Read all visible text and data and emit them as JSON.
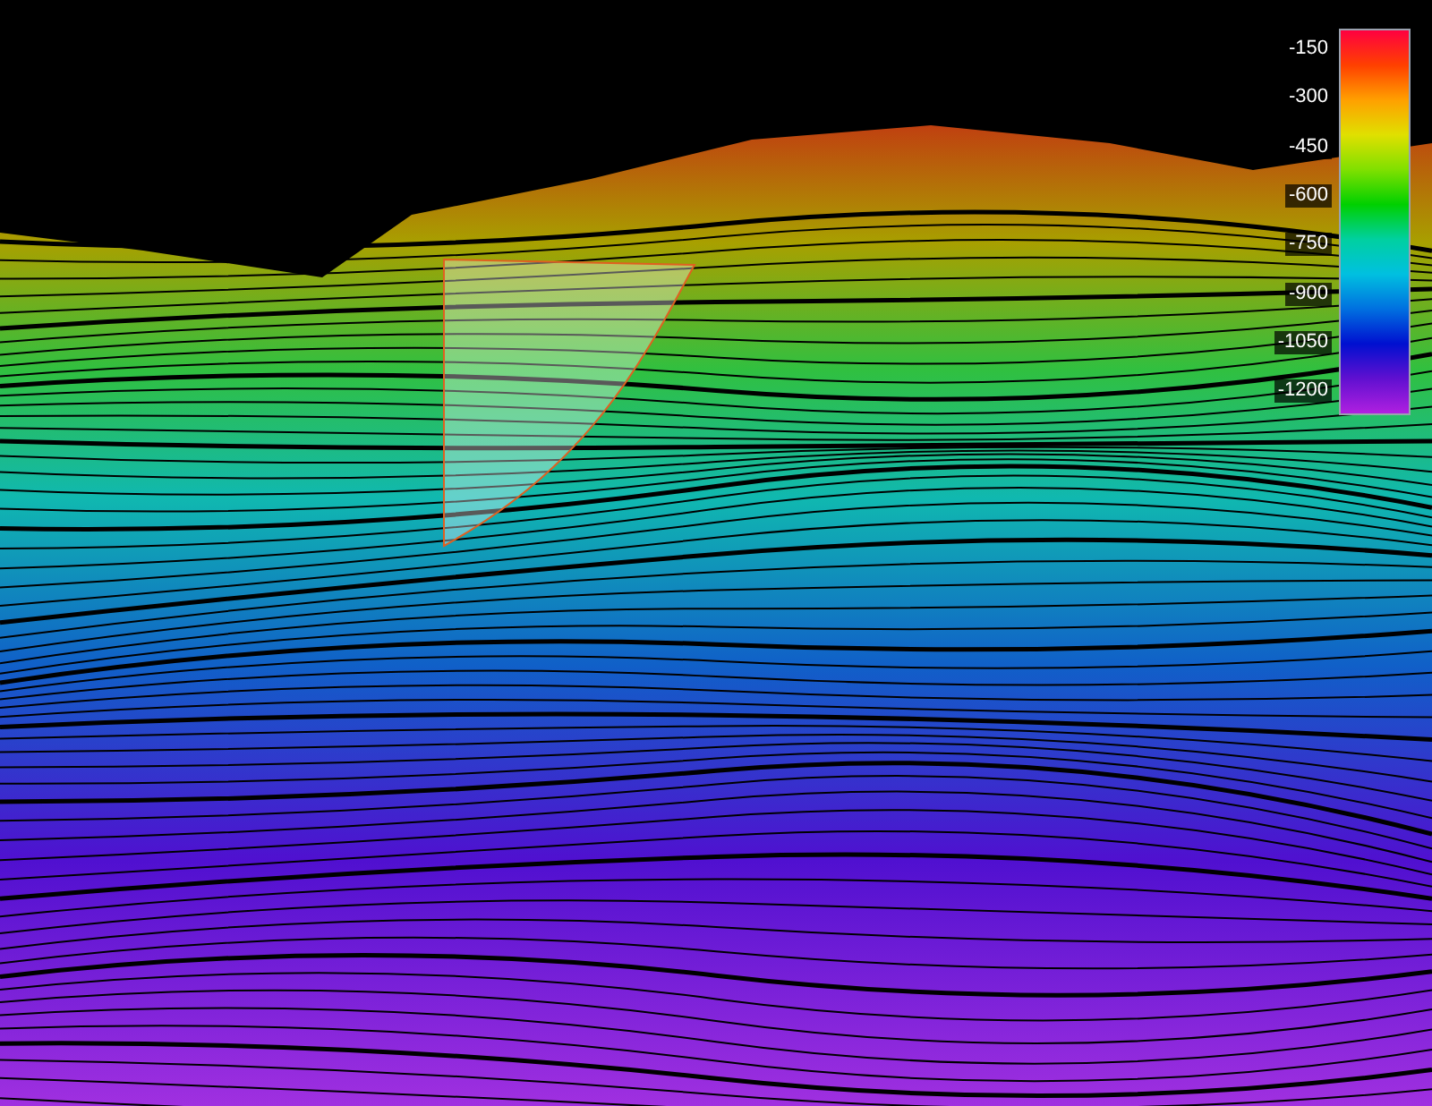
{
  "legend": {
    "ticks": [
      "-150",
      "-300",
      "-450",
      "-600",
      "-750",
      "-900",
      "-1050",
      "-1200"
    ]
  }
}
